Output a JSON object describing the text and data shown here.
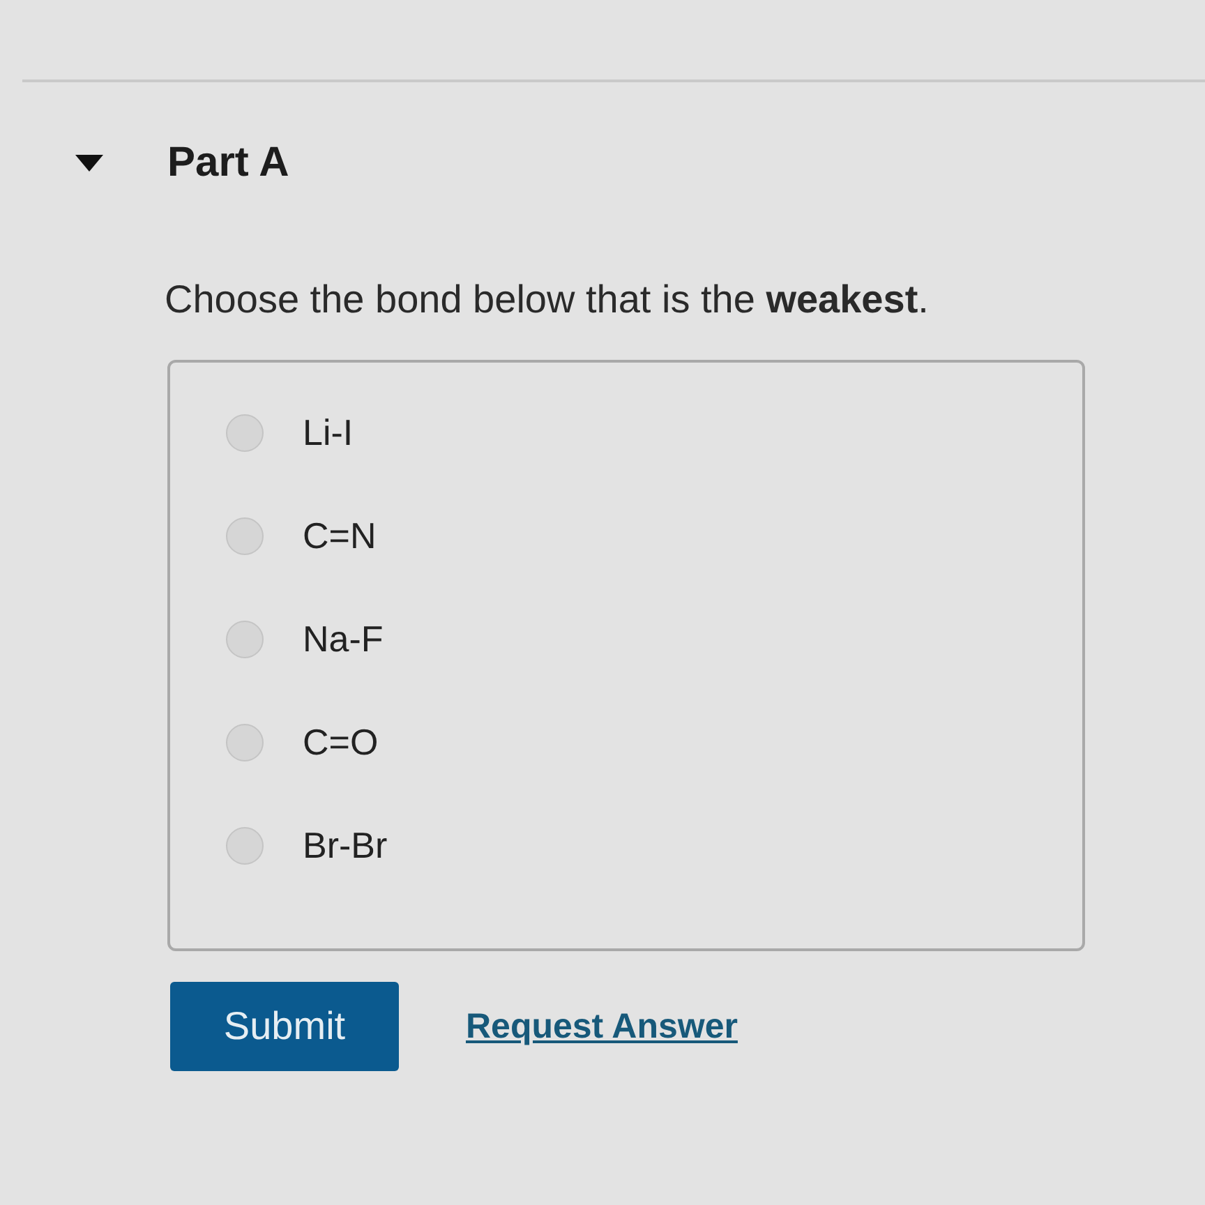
{
  "part": {
    "title": "Part A",
    "expanded": true
  },
  "question": "Choose the bond below that is the **weakest**.",
  "options": [
    {
      "label": "Li-I",
      "selected": false
    },
    {
      "label": "C=N",
      "selected": false
    },
    {
      "label": "Na-F",
      "selected": false
    },
    {
      "label": "C=O",
      "selected": false
    },
    {
      "label": "Br-Br",
      "selected": false
    }
  ],
  "actions": {
    "submit": "Submit",
    "request": "Request Answer"
  }
}
